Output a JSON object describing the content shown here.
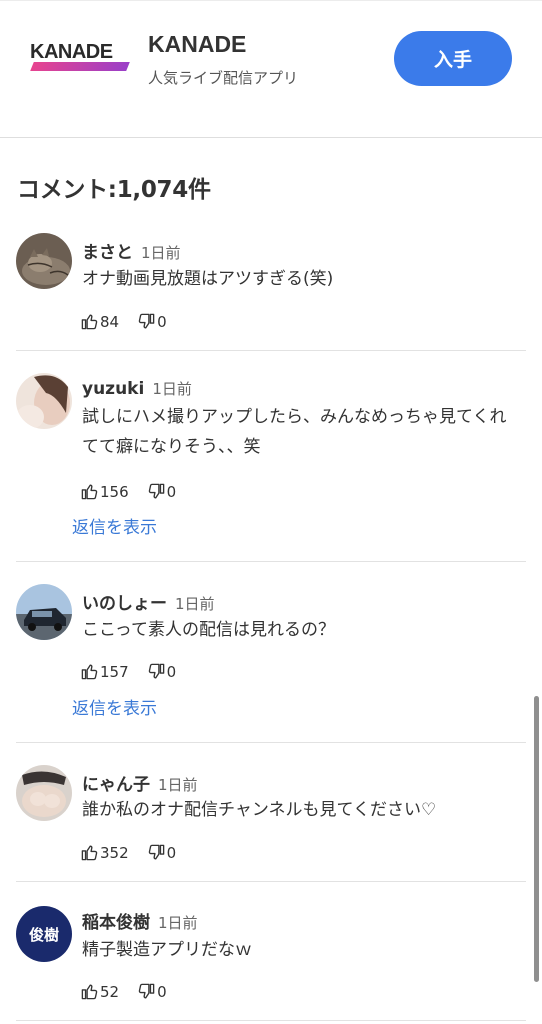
{
  "app_banner": {
    "logo_text": "KANADE",
    "app_name": "KANADE",
    "subtitle": "人気ライブ配信アプリ",
    "get_label": "入手"
  },
  "comments_header": "コメント:1,074件",
  "comments": [
    {
      "name": "まさと",
      "time": "1日前",
      "text": "オナ動画見放題はアツすぎる(笑)",
      "likes": "84",
      "dislikes": "0",
      "avatar_icon": "cat-photo-avatar"
    },
    {
      "name": "yuzuki",
      "time": "1日前",
      "text": "試しにハメ撮りアップしたら、みんなめっちゃ見てくれてて癖になりそう、、笑",
      "likes": "156",
      "dislikes": "0",
      "show_replies": "返信を表示",
      "avatar_icon": "woman-photo-avatar"
    },
    {
      "name": "いのしょー",
      "time": "1日前",
      "text": "ここって素人の配信は見れるの？",
      "likes": "157",
      "dislikes": "0",
      "show_replies": "返信を表示",
      "avatar_icon": "car-photo-avatar"
    },
    {
      "name": "にゃん子",
      "time": "1日前",
      "text": "誰か私のオナ配信チャンネルも見てください♡",
      "likes": "352",
      "dislikes": "0",
      "avatar_icon": "person-photo-avatar"
    },
    {
      "name": "稲本俊樹",
      "time": "1日前",
      "text": "精子製造アプリだなｗ",
      "likes": "52",
      "dislikes": "0",
      "avatar_text": "俊樹",
      "avatar_color": "#1a2a6c"
    }
  ],
  "colors": {
    "accent": "#3b7bea",
    "link": "#3a79d6"
  }
}
